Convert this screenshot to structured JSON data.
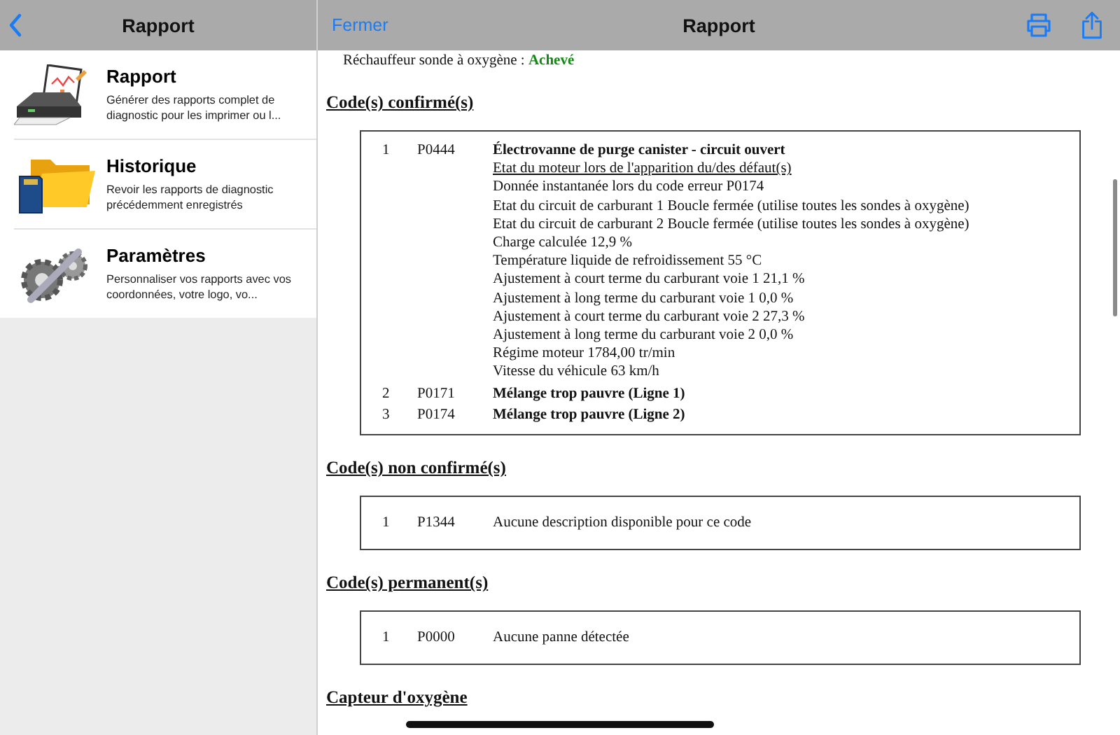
{
  "sidebar": {
    "title": "Rapport",
    "items": [
      {
        "kind": "report",
        "title": "Rapport",
        "description": "Générer des rapports complet de diagnostic pour les imprimer ou l...",
        "selected": false
      },
      {
        "kind": "history",
        "title": "Historique",
        "description": "Revoir les rapports de diagnostic précédemment enregistrés",
        "selected": false
      },
      {
        "kind": "settings",
        "title": "Paramètres",
        "description": "Personnaliser vos rapports avec vos coordonnées, votre logo, vo...",
        "selected": false
      }
    ]
  },
  "toolbar": {
    "close": "Fermer",
    "title": "Rapport"
  },
  "report": {
    "status_line": {
      "label": "Réchauffeur sonde à oxygène :",
      "value": "Achevé"
    },
    "sections": [
      {
        "heading": "Code(s) confirmé(s)",
        "rows": [
          {
            "number": "1",
            "code": "P0444",
            "title": "Électrovanne de purge canister - circuit ouvert",
            "details": [
              {
                "kind": "subheading",
                "text": "Etat du moteur lors de l'apparition du/des défaut(s)"
              },
              {
                "kind": "line",
                "text": "Donnée instantanée lors du code erreur P0174"
              },
              {
                "kind": "line",
                "text": "Etat du circuit de carburant 1 Boucle fermée (utilise toutes les sondes à oxygène)"
              },
              {
                "kind": "line",
                "text": "Etat du circuit de carburant 2 Boucle fermée (utilise toutes les sondes à oxygène)"
              },
              {
                "kind": "line",
                "text": "Charge calculée 12,9 %"
              },
              {
                "kind": "line",
                "text": "Température liquide de refroidissement 55 °C"
              },
              {
                "kind": "line",
                "text": "Ajustement à court terme du carburant voie 1 21,1 %"
              },
              {
                "kind": "line",
                "text": "Ajustement à long terme du carburant voie 1 0,0 %"
              },
              {
                "kind": "line",
                "text": "Ajustement à court terme du carburant voie 2 27,3 %"
              },
              {
                "kind": "line",
                "text": "Ajustement à long terme du carburant voie 2 0,0 %"
              },
              {
                "kind": "line",
                "text": "Régime moteur 1784,00 tr/min"
              },
              {
                "kind": "line",
                "text": "Vitesse du véhicule 63 km/h"
              }
            ]
          },
          {
            "number": "2",
            "code": "P0171",
            "title": "Mélange trop pauvre (Ligne 1)"
          },
          {
            "number": "3",
            "code": "P0174",
            "title": "Mélange trop pauvre (Ligne 2)"
          }
        ]
      },
      {
        "heading": "Code(s) non confirmé(s)",
        "rows": [
          {
            "number": "1",
            "code": "P1344",
            "description": "Aucune description disponible pour ce code"
          }
        ]
      },
      {
        "heading": "Code(s) permanent(s)",
        "rows": [
          {
            "number": "1",
            "code": "P0000",
            "description": "Aucune panne détectée"
          }
        ]
      },
      {
        "heading": "Capteur d'oxygène"
      }
    ]
  }
}
